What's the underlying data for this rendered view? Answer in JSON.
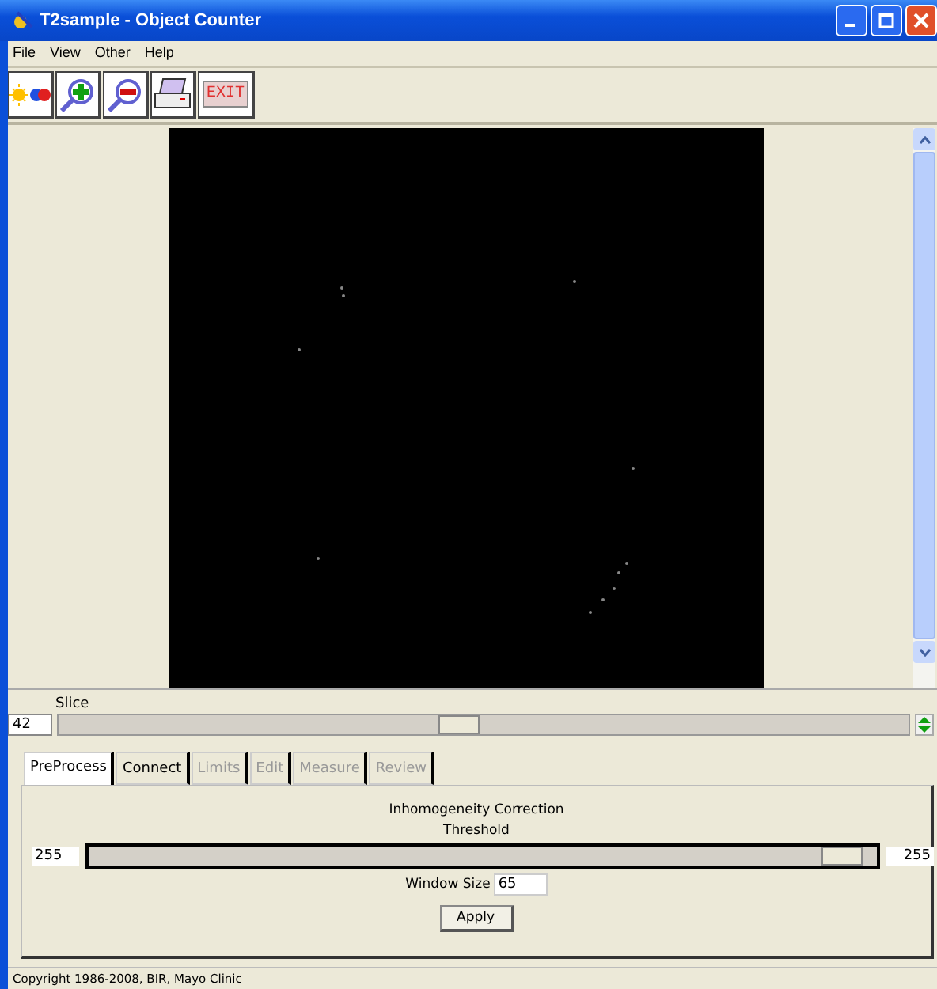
{
  "window": {
    "title": "T2sample - Object Counter"
  },
  "menu": [
    "File",
    "View",
    "Other",
    "Help"
  ],
  "toolbar": [
    {
      "kind": "sun"
    },
    {
      "kind": "zoom_in"
    },
    {
      "kind": "zoom_out"
    },
    {
      "kind": "print"
    },
    {
      "kind": "exit",
      "label": "EXIT"
    }
  ],
  "slice": {
    "label": "Slice",
    "value": "42",
    "level": 0.47
  },
  "tabs": [
    {
      "label": "PreProcess",
      "selected": true,
      "disabled": false
    },
    {
      "label": "Connect",
      "selected": false,
      "disabled": false
    },
    {
      "label": "Limits",
      "selected": false,
      "disabled": true
    },
    {
      "label": "Edit",
      "selected": false,
      "disabled": true
    },
    {
      "label": "Measure",
      "selected": false,
      "disabled": true
    },
    {
      "label": "Review",
      "selected": false,
      "disabled": true
    }
  ],
  "panel": {
    "heading": "Inhomogeneity Correction",
    "threshold_label": "Threshold",
    "min_value": "255",
    "max_value": "255",
    "level": 0.98,
    "window_size_label": "Window Size",
    "window_size": "65",
    "apply": "Apply"
  },
  "status_bar": "Copyright 1986-2008, BIR, Mayo Clinic"
}
